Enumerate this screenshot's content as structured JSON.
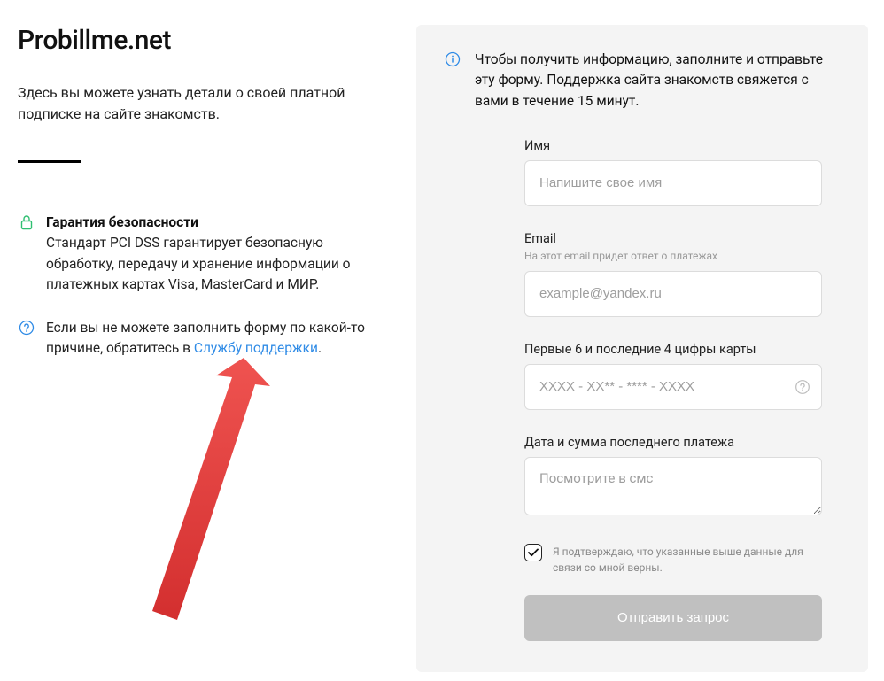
{
  "left": {
    "site_title": "Probillme.net",
    "intro": "Здесь вы можете узнать детали о своей платной подписке на сайте знакомств.",
    "security": {
      "title": "Гарантия безопасности",
      "body": "Стандарт PCI DSS гарантирует безопасную обработку, передачу и хранение информации о платежных картах Visa, MasterCard и МИР."
    },
    "help": {
      "prefix": "Если вы не можете заполнить форму по какой-то причине, обратитесь в ",
      "link_text": "Службу поддержки",
      "suffix": "."
    }
  },
  "right": {
    "header_text": "Чтобы получить информацию, заполните и отправьте эту форму. Поддержка сайта знакомств свяжется с вами в течение 15 минут.",
    "fields": {
      "name": {
        "label": "Имя",
        "placeholder": "Напишите свое имя"
      },
      "email": {
        "label": "Email",
        "hint": "На этот email придет ответ о платежах",
        "placeholder": "example@yandex.ru"
      },
      "card": {
        "label": "Первые 6 и последние 4 цифры карты",
        "placeholder": "XXXX - XX** - **** - XXXX"
      },
      "payment": {
        "label": "Дата и сумма последнего платежа",
        "placeholder": "Посмотрите в смс"
      }
    },
    "confirm_label": "Я подтверждаю, что указанные выше данные для связи со мной верны.",
    "submit_label": "Отправить запрос"
  },
  "colors": {
    "link": "#2f8be6",
    "icon_blue": "#2f8be6",
    "icon_green": "#2fbf71",
    "arrow": "#e53935"
  }
}
